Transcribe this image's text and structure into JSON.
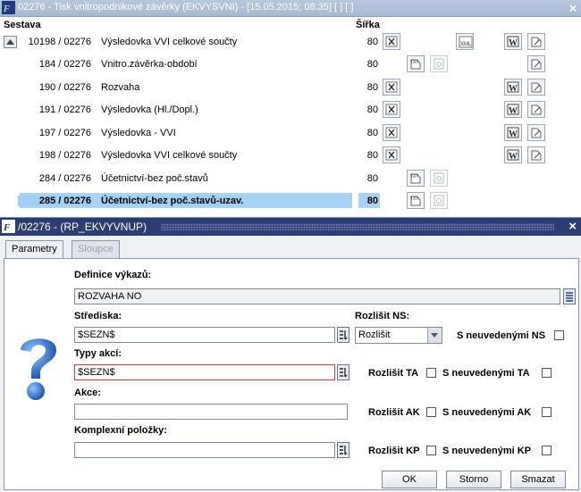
{
  "background_window": {
    "title": "02276 - Tisk vnitropodnikové závěrky (EKVYSVNI) - [15.05.2015; 08:35]  [ ]  [ ]",
    "columns": {
      "report": "Sestava",
      "width": "Šířka"
    },
    "rows": [
      {
        "code": "10198 / 02276",
        "name": "Výsledovka VVI celkové součty",
        "width": "80",
        "selected": false
      },
      {
        "code": "184 / 02276",
        "name": "Vnitro.závěrka-období",
        "width": "80",
        "selected": false
      },
      {
        "code": "190 / 02276",
        "name": "Rozvaha",
        "width": "80",
        "selected": false
      },
      {
        "code": "191 / 02276",
        "name": "Výsledovka (Hl./Dopl.)",
        "width": "80",
        "selected": false
      },
      {
        "code": "197 / 02276",
        "name": "Výsledovka - VVI",
        "width": "80",
        "selected": false
      },
      {
        "code": "198 / 02276",
        "name": "Výsledovka VVI celkové součty",
        "width": "80",
        "selected": false
      },
      {
        "code": "284 / 02276",
        "name": "Účetnictví-bez poč.stavů",
        "width": "80",
        "selected": false
      },
      {
        "code": "285 / 02276",
        "name": "Účetnictví-bez poč.stavů-uzav.",
        "width": "80",
        "selected": true
      }
    ]
  },
  "dialog": {
    "title": "/02276 - (RP_EKVYVNUP)",
    "tabs": [
      {
        "label": "Parametry",
        "active": true
      },
      {
        "label": "Sloupce",
        "active": false
      }
    ],
    "fields": {
      "definice": {
        "label": "Definice výkazů:",
        "value": "ROZVAHA NO"
      },
      "strediska": {
        "label": "Střediska:",
        "value": "$SEZN$"
      },
      "rozlisit_ns": {
        "label": "Rozlišit NS:",
        "value": "Rozlišit"
      },
      "s_neuvedenymi_ns": {
        "label": "S neuvedenými NS",
        "checked": false
      },
      "typy_akci": {
        "label": "Typy akcí:",
        "value": "$SEZN$"
      },
      "rozlisit_ta": {
        "label": "Rozlišit TA",
        "checked": false
      },
      "s_neuvedenymi_ta": {
        "label": "S neuvedenými TA",
        "checked": false
      },
      "akce": {
        "label": "Akce:",
        "value": ""
      },
      "rozlisit_ak": {
        "label": "Rozlišit AK",
        "checked": false
      },
      "s_neuvedenymi_ak": {
        "label": "S neuvedenými AK",
        "checked": false
      },
      "komplexni": {
        "label": "Komplexní položky:",
        "value": ""
      },
      "rozlisit_kp": {
        "label": "Rozlišit KP",
        "checked": false
      },
      "s_neuvedenymi_kp": {
        "label": "S neuvedenými KP",
        "checked": false
      }
    },
    "buttons": {
      "ok": "OK",
      "storno": "Storno",
      "smazat": "Smazat"
    }
  },
  "colors": {
    "dialog_title": "#2c3d73",
    "selection": "#a8d3f5",
    "error_border": "#d13a3a"
  }
}
